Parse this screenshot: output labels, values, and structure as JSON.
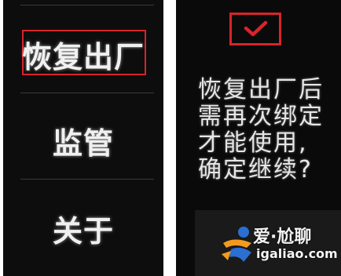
{
  "left_screen": {
    "menu": [
      {
        "label": "恢复出厂",
        "selected": true
      },
      {
        "label": "监管",
        "selected": false
      },
      {
        "label": "关于",
        "selected": false
      }
    ]
  },
  "right_screen": {
    "confirm_icon": "checkmark-icon",
    "prompt_lines": [
      "恢复出厂后",
      "需再次绑定",
      "才能使用,",
      "确定继续?"
    ]
  },
  "watermark": {
    "title": "爱·尬聊",
    "url": "igaliao.com"
  },
  "colors": {
    "highlight": "#d8242b",
    "screen_bg": "#0d0d0d",
    "text": "#f0f0f0",
    "logo_blue": "#2a6fd1",
    "logo_orange": "#f29a1f"
  }
}
